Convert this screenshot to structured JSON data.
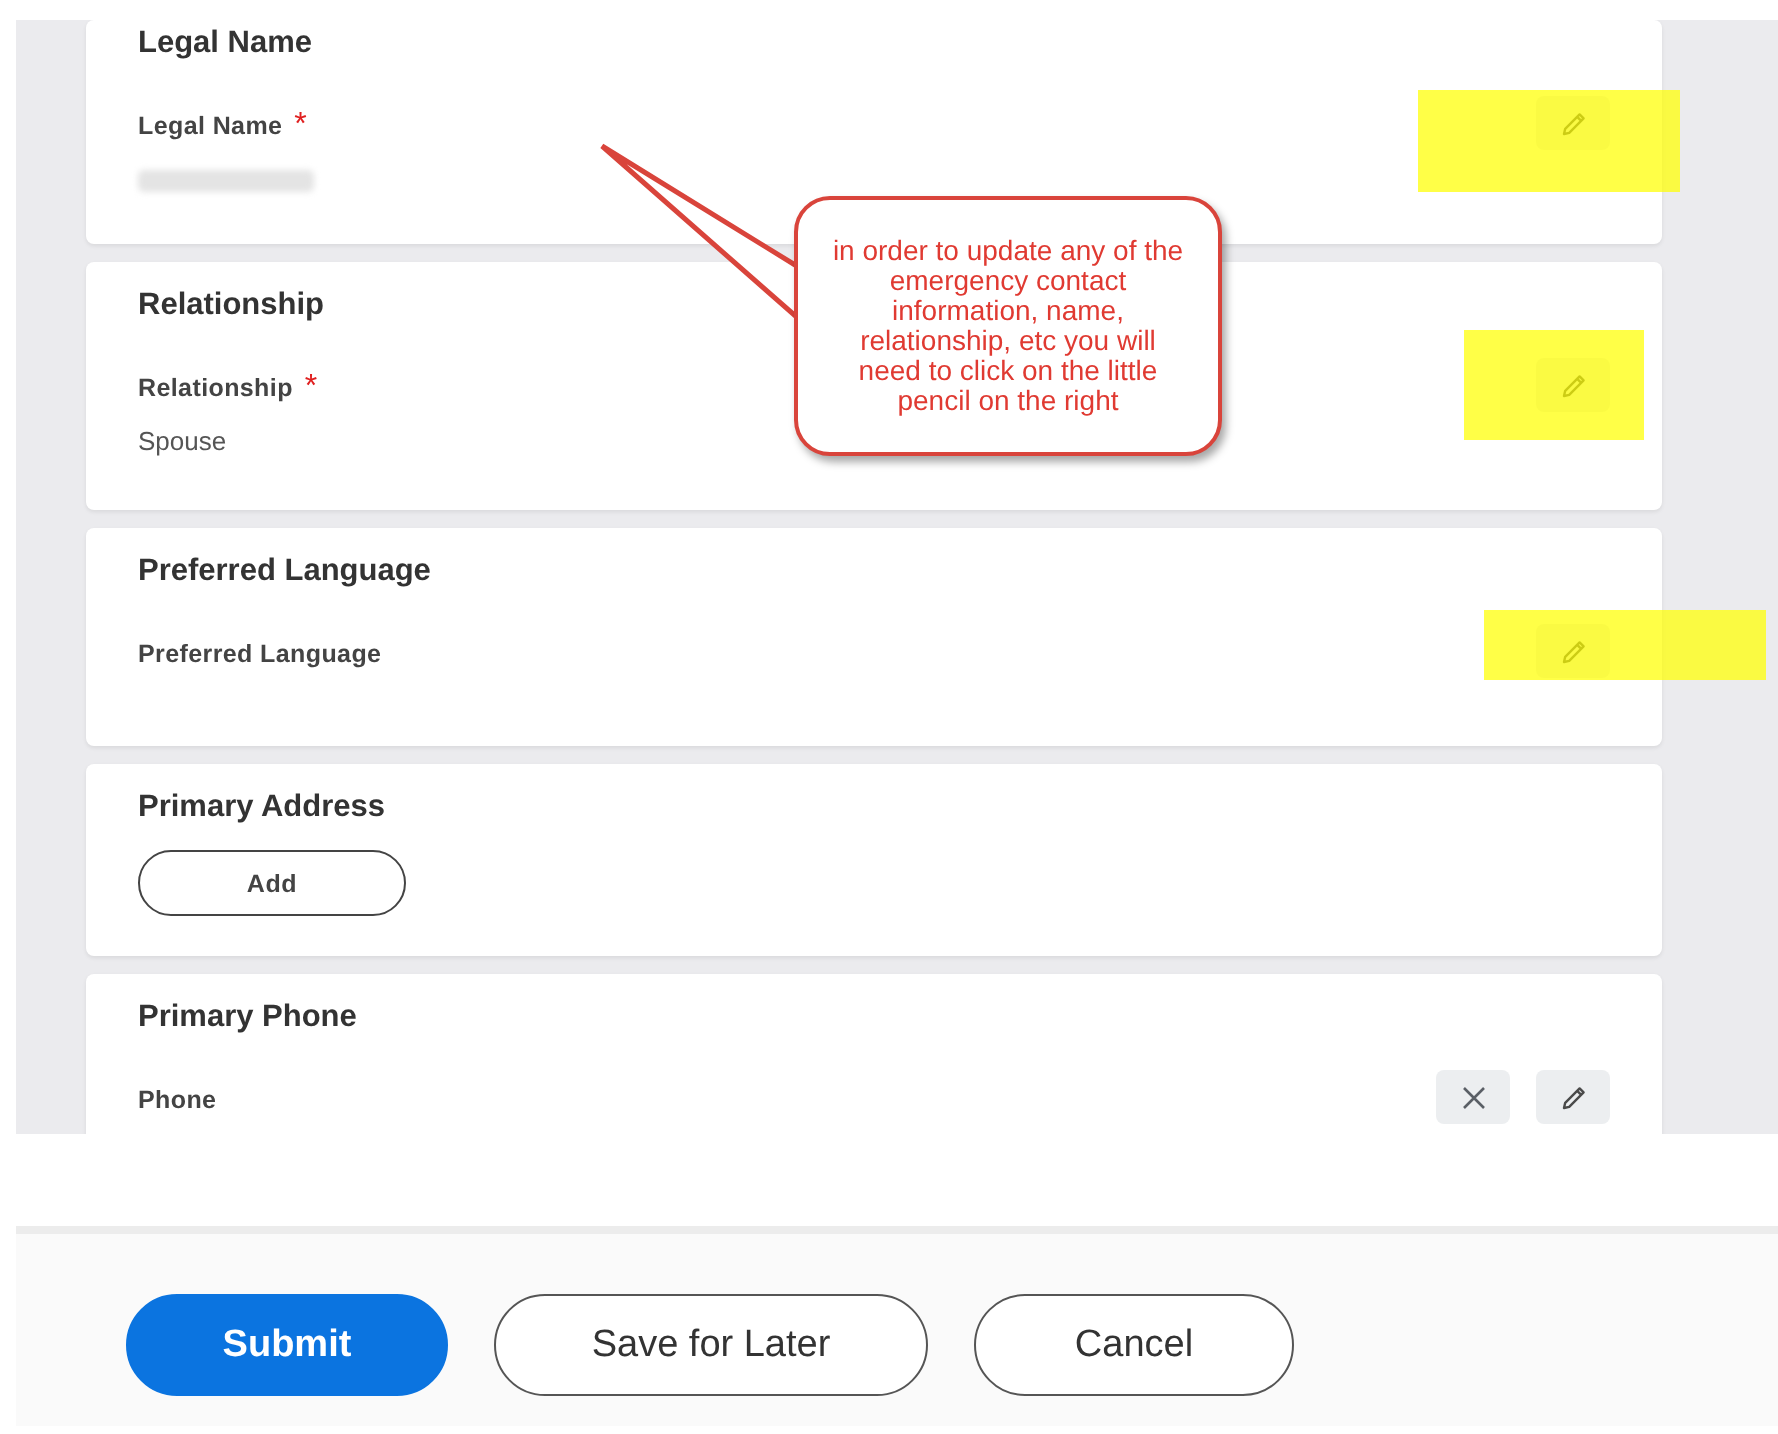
{
  "sections": [
    {
      "title": "Legal Name",
      "kind": "field",
      "field": {
        "label": "Legal Name",
        "required_mark": "*",
        "value_redacted": true,
        "highlighted": true
      },
      "actions": [
        {
          "kind": "edit"
        }
      ]
    },
    {
      "title": "Relationship",
      "kind": "field",
      "field": {
        "label": "Relationship",
        "required_mark": "*",
        "value": "Spouse",
        "highlighted": true
      },
      "actions": [
        {
          "kind": "edit"
        }
      ]
    },
    {
      "title": "Preferred Language",
      "kind": "field",
      "field": {
        "label": "Preferred Language",
        "highlighted": true
      },
      "actions": [
        {
          "kind": "edit"
        }
      ]
    },
    {
      "title": "Primary Address",
      "kind": "add",
      "add_label": "Add"
    },
    {
      "title": "Primary Phone",
      "kind": "field",
      "field": {
        "label": "Phone",
        "highlighted": false
      },
      "actions": [
        {
          "kind": "remove"
        },
        {
          "kind": "edit"
        }
      ]
    }
  ],
  "callout": {
    "text": "in order to update any of the emergency contact information, name, relationship, etc you will need to click on the little pencil on the right"
  },
  "footer": {
    "buttons": [
      {
        "label": "Submit",
        "kind": "primary"
      },
      {
        "label": "Save for Later",
        "kind": "secondary"
      },
      {
        "label": "Cancel",
        "kind": "secondary"
      }
    ]
  }
}
